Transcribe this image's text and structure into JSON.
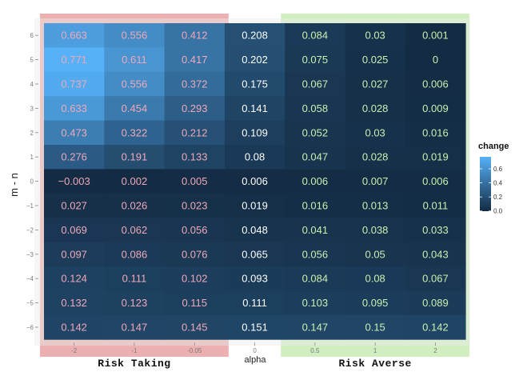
{
  "chart_data": {
    "type": "heatmap",
    "xlabel": "alpha",
    "ylabel": "m - n",
    "x_categories": [
      "-2",
      "-1",
      "-0.05",
      "0",
      "0.5",
      "1",
      "2"
    ],
    "y_categories": [
      "6",
      "5",
      "4",
      "3",
      "2",
      "1",
      "0",
      "-1",
      "-2",
      "-3",
      "-4",
      "-5",
      "-6"
    ],
    "y_tick_labels": [
      "6",
      "5",
      "4",
      "3",
      "2",
      "1",
      "0",
      "−1",
      "−2",
      "−3",
      "−4",
      "−5",
      "−6"
    ],
    "values": [
      [
        "0.663",
        "0.556",
        "0.412",
        "0.208",
        "0.084",
        "0.03",
        "0.001"
      ],
      [
        "0.771",
        "0.611",
        "0.417",
        "0.202",
        "0.075",
        "0.025",
        "0"
      ],
      [
        "0.737",
        "0.556",
        "0.372",
        "0.175",
        "0.067",
        "0.027",
        "0.006"
      ],
      [
        "0.633",
        "0.454",
        "0.293",
        "0.141",
        "0.058",
        "0.028",
        "0.009"
      ],
      [
        "0.473",
        "0.322",
        "0.212",
        "0.109",
        "0.052",
        "0.03",
        "0.016"
      ],
      [
        "0.276",
        "0.191",
        "0.133",
        "0.08",
        "0.047",
        "0.028",
        "0.019"
      ],
      [
        "−0.003",
        "0.002",
        "0.005",
        "0.006",
        "0.006",
        "0.007",
        "0.006"
      ],
      [
        "0.027",
        "0.026",
        "0.023",
        "0.019",
        "0.016",
        "0.013",
        "0.011"
      ],
      [
        "0.069",
        "0.062",
        "0.056",
        "0.048",
        "0.041",
        "0.038",
        "0.033"
      ],
      [
        "0.097",
        "0.086",
        "0.076",
        "0.065",
        "0.056",
        "0.05",
        "0.043"
      ],
      [
        "0.124",
        "0.111",
        "0.102",
        "0.093",
        "0.084",
        "0.08",
        "0.067"
      ],
      [
        "0.132",
        "0.123",
        "0.115",
        "0.111",
        "0.103",
        "0.095",
        "0.089"
      ],
      [
        "0.142",
        "0.147",
        "0.145",
        "0.151",
        "0.147",
        "0.15",
        "0.142"
      ]
    ],
    "legend": {
      "title": "change",
      "ticks": [
        "0.6",
        "0.4",
        "0.2",
        "0.0"
      ],
      "tick_values": [
        0.6,
        0.4,
        0.2,
        0.0
      ],
      "range": [
        -0.003,
        0.771
      ],
      "low_color": "#132b43",
      "high_color": "#56b1f7",
      "placement": "right"
    },
    "groups": [
      {
        "label": "Risk Taking",
        "columns": [
          "-2",
          "-1",
          "-0.05"
        ],
        "color": "#e08080",
        "label_color": "#f0a8b8"
      },
      {
        "label": "Risk Averse",
        "columns": [
          "0.5",
          "1",
          "2"
        ],
        "color": "#b5e39a",
        "label_color": "#c8f0b0"
      }
    ],
    "neutral_label_color": "#ffffff",
    "panel_background": "#ebebeb",
    "grid": false
  }
}
